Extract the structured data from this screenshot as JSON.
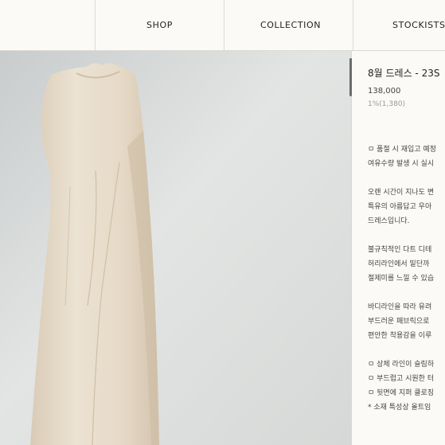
{
  "nav": {
    "items": [
      {
        "label": "SHOP"
      },
      {
        "label": "COLLECTION"
      },
      {
        "label": "STOCKISTS"
      }
    ]
  },
  "product": {
    "image_icon": "dress-photo",
    "title": "8월 드레스 - 23S",
    "price": "138,000",
    "points": "1%(1,380)",
    "description": [
      "ㅁ 품절 시 재입고 예정",
      "여유수량 발생 시 실시",
      "오랜 시간이 지나도 변",
      "특유의 아름답고 우아",
      "드레스입니다.",
      "불규칙적인 다트 디테",
      "허리라인에서 밑단까",
      "절제미를 느낄 수 있습",
      "바디라인을 따라 유려",
      "부드러운 패브릭으로",
      "편안한 착용감을 이루",
      "ㅁ 상체 라인이 슬림하",
      "ㅁ 부드럽고 시원한 터",
      "ㅁ 뒷면에 지퍼 클로징",
      "* 소재 특성상 올트임"
    ]
  },
  "colors": {
    "background": "#fbfaf7",
    "border": "#dcdad5",
    "dress": "#e7dccb",
    "photo_bg": "#dfe1e0"
  }
}
